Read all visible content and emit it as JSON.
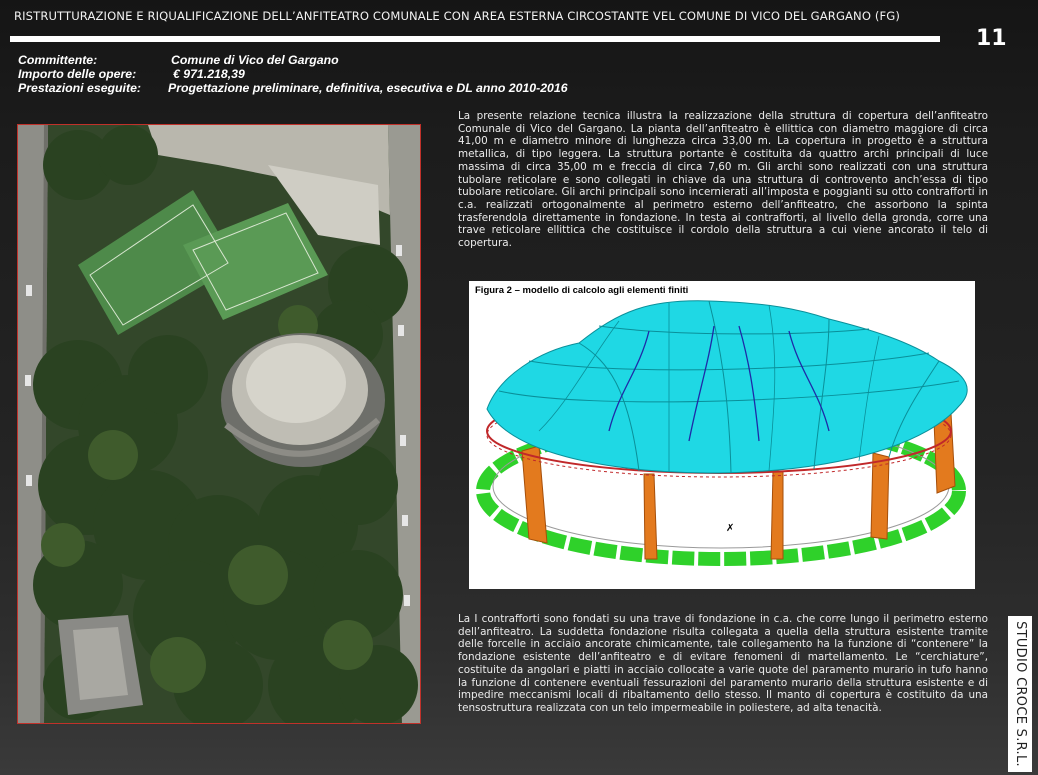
{
  "header": {
    "title": "RISTRUTTURAZIONE E RIQUALIFICAZIONE DELL’ANFITEATRO COMUNALE CON AREA ESTERNA CIRCOSTANTE VEL COMUNE DI VICO DEL GARGANO (FG)",
    "page_number": "11"
  },
  "info": {
    "committente_label": "Committente:",
    "committente_value": "Comune di Vico del Gargano",
    "importo_label": "Importo delle opere:",
    "importo_value": "€ 971.218,39",
    "prestazioni_label": "Prestazioni eseguite:",
    "prestazioni_value": "Progettazione  preliminare, definitiva, esecutiva e DL anno 2010-2016"
  },
  "paragraph1": "La presente relazione tecnica illustra la realizzazione della struttura di copertura dell’anfiteatro Comunale di Vico del Gargano. La pianta dell’anfiteatro è ellittica con diametro maggiore di circa 41,00 m e diametro minore di lunghezza circa 33,00 m. La copertura in progetto è a struttura metallica, di tipo leggera. La struttura portante è costituita da quattro archi principali di luce massima di circa 35,00 m e freccia di circa 7,60 m. Gli archi sono realizzati con una struttura tubolare reticolare e sono collegati in chiave da una struttura di controvento anch’essa di tipo tubolare reticolare. Gli archi principali sono incernierati all’imposta e poggianti su otto contrafforti in c.a. realizzati ortogonalmente al perimetro esterno dell’anfiteatro, che assorbono la spinta trasferendola direttamente in fondazione. In testa ai contrafforti, al livello della gronda, corre una trave reticolare ellittica che costituisce il cordolo della struttura a cui viene ancorato il telo di copertura.",
  "figure": {
    "caption": "Figura 2 – modello di calcolo agli elementi finiti"
  },
  "paragraph2": "La I contrafforti sono fondati su una trave di fondazione in c.a. che corre lungo il perimetro esterno dell’anfiteatro. La suddetta fondazione risulta collegata a quella della struttura esistente tramite delle forcelle in acciaio ancorate chimicamente, tale collegamento ha la funzione di “contenere” la fondazione esistente dell’anfiteatro e di evitare fenomeni di martellamento. Le “cerchiature”, costituite da angolari e piatti in acciaio collocate a varie quote del paramento murario in tufo hanno la funzione di contenere eventuali fessurazioni del paramento murario della struttura esistente e di impedire meccanismi locali di ribaltamento dello stesso. Il manto di copertura è costituito da una tensostruttura realizzata con un telo impermeabile in poliestere, ad alta tenacità.",
  "footer": {
    "studio": "STUDIO CROCE S.R.L."
  },
  "colors": {
    "photo_border": "#c0312a",
    "roof": "#1fd8e4",
    "buttress": "#e37a1e",
    "foundation": "#2fd12a",
    "ring_beam": "#c0282a"
  }
}
